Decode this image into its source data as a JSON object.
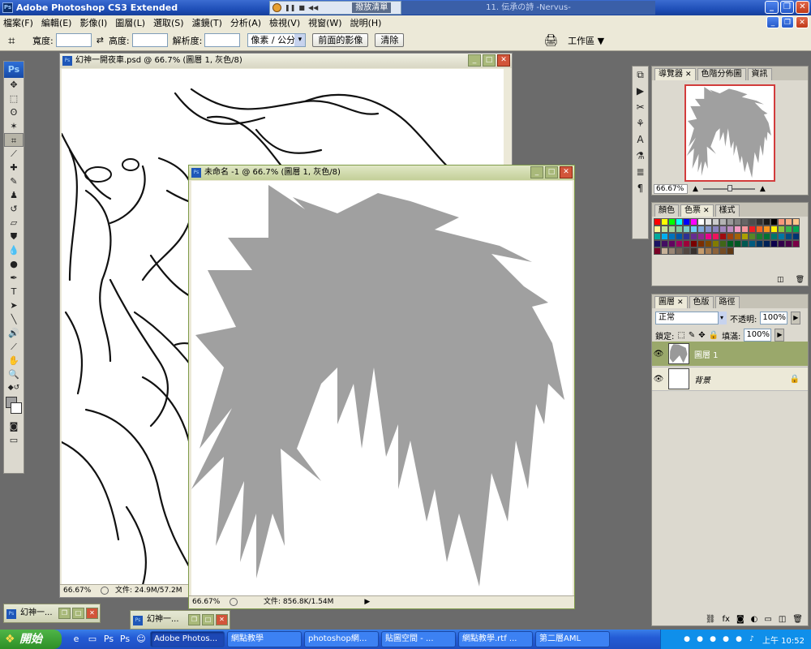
{
  "app": {
    "title": "Adobe Photoshop CS3 Extended",
    "ps_badge": "Ps"
  },
  "media": {
    "tab": "撥放清單",
    "track": "11. 伝承の詩 -Nervus-"
  },
  "menu": [
    "檔案(F)",
    "編輯(E)",
    "影像(I)",
    "圖層(L)",
    "選取(S)",
    "濾鏡(T)",
    "分析(A)",
    "檢視(V)",
    "視窗(W)",
    "說明(H)"
  ],
  "options": {
    "width_label": "寬度:",
    "height_label": "高度:",
    "resolution_label": "解析度:",
    "unit": "像素 / 公分",
    "front_image": "前面的影像",
    "clear": "清除",
    "workspace": "工作區 ▼"
  },
  "doc1": {
    "title": "幻神一開夜車.psd @ 66.7% (圖層 1, 灰色/8)",
    "zoom": "66.67%",
    "status": "文件: 24.9M/57.2M"
  },
  "doc2": {
    "title": "未命名 -1 @ 66.7% (圖層 1, 灰色/8)",
    "zoom": "66.67%",
    "status": "文件: 856.8K/1.54M"
  },
  "minimized": [
    {
      "label": "幻神一..."
    },
    {
      "label": "幻神一..."
    }
  ],
  "navigator": {
    "tabs": [
      "導覽器",
      "色階分佈圖",
      "資訊"
    ],
    "zoom": "66.67%"
  },
  "swatches": {
    "tabs": [
      "顏色",
      "色票",
      "樣式"
    ],
    "colors": [
      "#ff0000",
      "#ffff00",
      "#00ff00",
      "#00ffff",
      "#0000ff",
      "#ff00ff",
      "#ffffff",
      "#e6e6e6",
      "#cccccc",
      "#b3b3b3",
      "#999999",
      "#808080",
      "#666666",
      "#4d4d4d",
      "#333333",
      "#1a1a1a",
      "#000000",
      "#f7977a",
      "#f9ad81",
      "#fdc68a",
      "#fff79a",
      "#c4df9b",
      "#a2d39c",
      "#82ca9d",
      "#7bcdc8",
      "#6ecff6",
      "#7ea7d8",
      "#8493ca",
      "#8882be",
      "#a187be",
      "#bc8dbf",
      "#f49ac2",
      "#f6989d",
      "#ed1c24",
      "#f26522",
      "#f7941d",
      "#fff200",
      "#8dc63f",
      "#39b54a",
      "#00a651",
      "#00a99d",
      "#00aeef",
      "#0072bc",
      "#0054a6",
      "#2e3192",
      "#662d91",
      "#92278f",
      "#ec008c",
      "#ed145b",
      "#9e0b0f",
      "#a0410d",
      "#a36209",
      "#aba000",
      "#598527",
      "#1a7b30",
      "#007236",
      "#00746b",
      "#0076a3",
      "#004b80",
      "#003471",
      "#1b1464",
      "#440e62",
      "#630460",
      "#9e005d",
      "#9e0039",
      "#790000",
      "#7b2e00",
      "#7d4900",
      "#827b00",
      "#406618",
      "#005e20",
      "#005826",
      "#005952",
      "#005b7f",
      "#003663",
      "#002157",
      "#0d004c",
      "#32004b",
      "#4b0049",
      "#7b0046",
      "#7a0026",
      "#c7b299",
      "#998675",
      "#736357",
      "#534741",
      "#37302d",
      "#c69c6d",
      "#a67c52",
      "#8c6239",
      "#754c24",
      "#603913"
    ]
  },
  "layers": {
    "tabs": [
      "圖層",
      "色版",
      "路徑"
    ],
    "blend_mode": "正常",
    "opacity_label": "不透明:",
    "opacity": "100%",
    "lock_label": "鎖定:",
    "fill_label": "填滿:",
    "fill": "100%",
    "items": [
      {
        "name": "圖層 1",
        "active": true
      },
      {
        "name": "背景",
        "active": false
      }
    ]
  },
  "taskbar": {
    "start": "開始",
    "tasks": [
      "Adobe Photos...",
      "網點教學",
      "photoshop網...",
      "貼圖空間 - ...",
      "網點教學.rtf ...",
      "第二層AML"
    ],
    "clock": "上午 10:52"
  }
}
